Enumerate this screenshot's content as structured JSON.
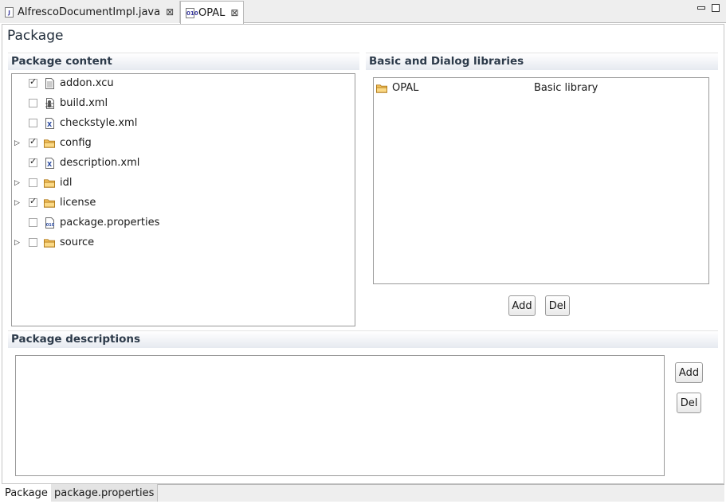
{
  "editor_tabs": [
    {
      "label": "AlfrescoDocumentImpl.java",
      "icon": "java-file-icon"
    },
    {
      "label": "OPAL",
      "icon": "properties-file-icon"
    }
  ],
  "page_title": "Package",
  "package_content": {
    "heading": "Package content",
    "items": [
      {
        "label": "addon.xcu",
        "expandable": false,
        "checked": true,
        "icon": "document-icon"
      },
      {
        "label": "build.xml",
        "expandable": false,
        "checked": false,
        "icon": "ant-file-icon"
      },
      {
        "label": "checkstyle.xml",
        "expandable": false,
        "checked": false,
        "icon": "xml-file-icon"
      },
      {
        "label": "config",
        "expandable": true,
        "checked": true,
        "icon": "folder-icon"
      },
      {
        "label": "description.xml",
        "expandable": false,
        "checked": true,
        "icon": "xml-file-icon"
      },
      {
        "label": "idl",
        "expandable": true,
        "checked": false,
        "icon": "folder-icon"
      },
      {
        "label": "license",
        "expandable": true,
        "checked": true,
        "icon": "folder-icon"
      },
      {
        "label": "package.properties",
        "expandable": false,
        "checked": false,
        "icon": "properties-file-icon"
      },
      {
        "label": "source",
        "expandable": true,
        "checked": false,
        "icon": "folder-icon"
      }
    ]
  },
  "libraries": {
    "heading": "Basic and Dialog libraries",
    "rows": [
      {
        "name": "OPAL",
        "type": "Basic library",
        "icon": "folder-icon"
      }
    ],
    "add_label": "Add",
    "del_label": "Del"
  },
  "descriptions": {
    "heading": "Package descriptions",
    "add_label": "Add",
    "del_label": "Del"
  },
  "bottom_tabs": [
    {
      "label": "Package",
      "active": true
    },
    {
      "label": "package.properties",
      "active": false
    }
  ]
}
